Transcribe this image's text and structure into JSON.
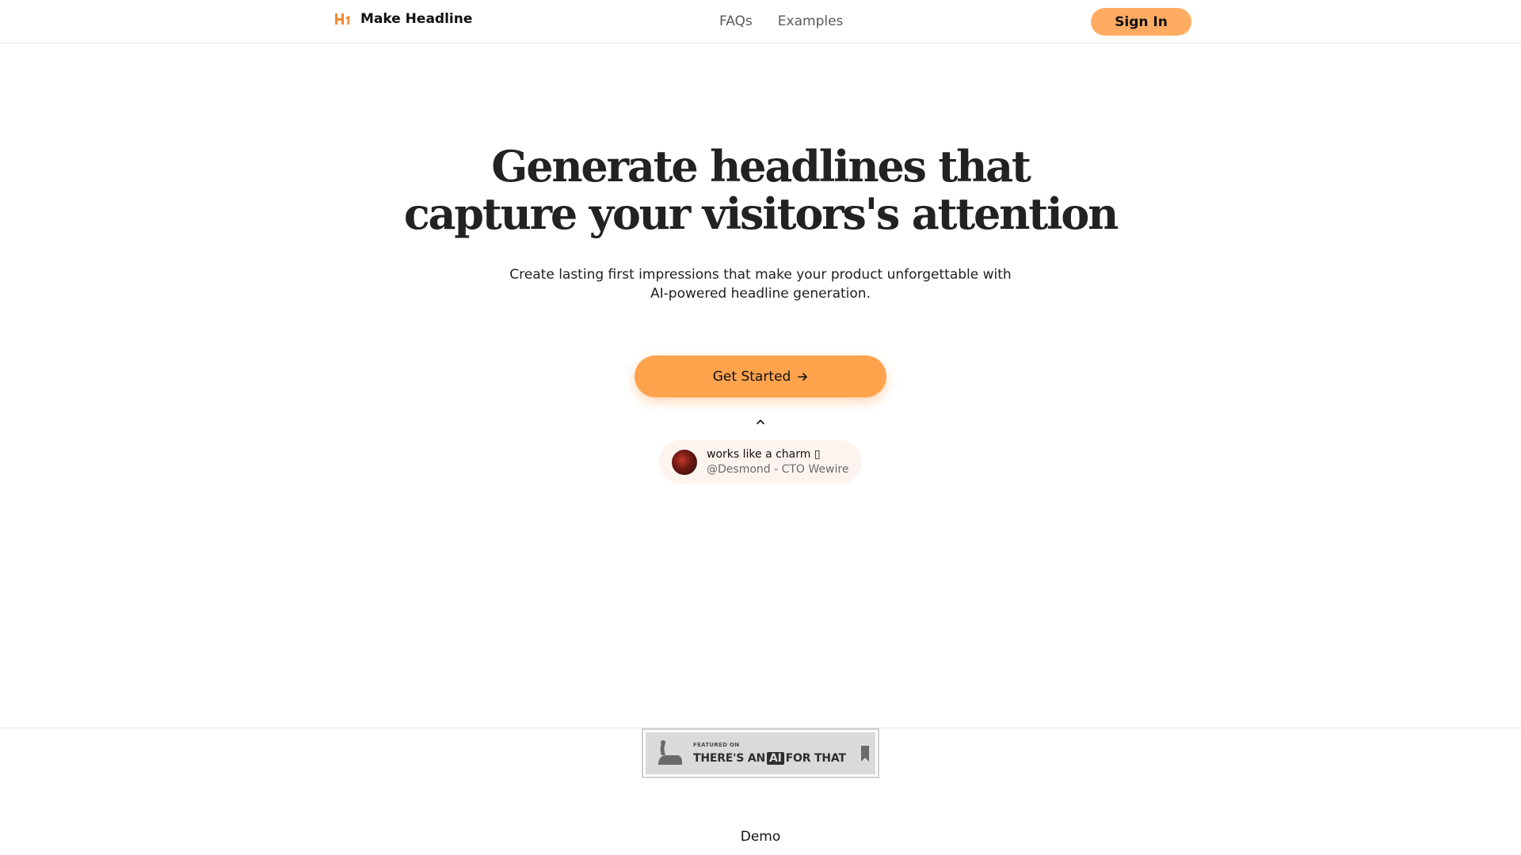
{
  "header": {
    "brand_name": "Make Headline",
    "nav": [
      {
        "label": "FAQs"
      },
      {
        "label": "Examples"
      }
    ],
    "signin_label": "Sign In"
  },
  "hero": {
    "title_line1": "Generate headlines that",
    "title_line2": "capture your visitors's attention",
    "subtitle": "Create lasting first impressions that make your product unforgettable with AI-powered headline generation.",
    "cta_label": "Get Started"
  },
  "testimonial": {
    "quote": "works like a charm ▯",
    "author": "@Desmond - CTO Wewire"
  },
  "badge": {
    "small_text": "FEATURED ON",
    "big_prefix": "THERE'S AN",
    "big_ai": "AI",
    "big_suffix": "FOR THAT"
  },
  "footer": {
    "demo_label": "Demo"
  },
  "colors": {
    "accent": "#ffa34d",
    "signin_bg": "#ffac62",
    "brand_icon": "#f28a2e",
    "testimonial_bg": "#fdf4ef"
  },
  "icons": {
    "brand": "h1-logo-icon",
    "cta": "arrow-right-icon",
    "toggle": "chevron-up-icon",
    "badge_logo": "robot-arm-icon",
    "badge_mark": "bookmark-icon"
  }
}
